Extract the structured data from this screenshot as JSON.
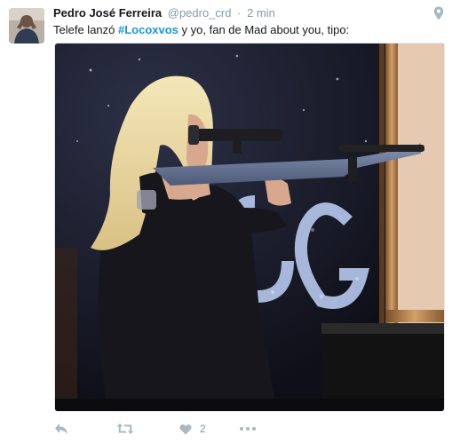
{
  "tweet": {
    "author_name": "Pedro José Ferreira",
    "author_handle": "@pedro_crd",
    "separator": "·",
    "time": "2 min",
    "text_before": "Telefe lanzó ",
    "hashtag": "#Locoxvos",
    "text_after": " y yo, fan de Mad about you, tipo:",
    "likes_count": "2"
  },
  "icons": {
    "location": "location-pin-icon",
    "reply": "reply-icon",
    "retweet": "retweet-icon",
    "like": "heart-icon",
    "more": "more-dots-icon"
  },
  "colors": {
    "hashtag": "#1b95e0",
    "muted": "#8899a6",
    "text": "#14171a"
  }
}
